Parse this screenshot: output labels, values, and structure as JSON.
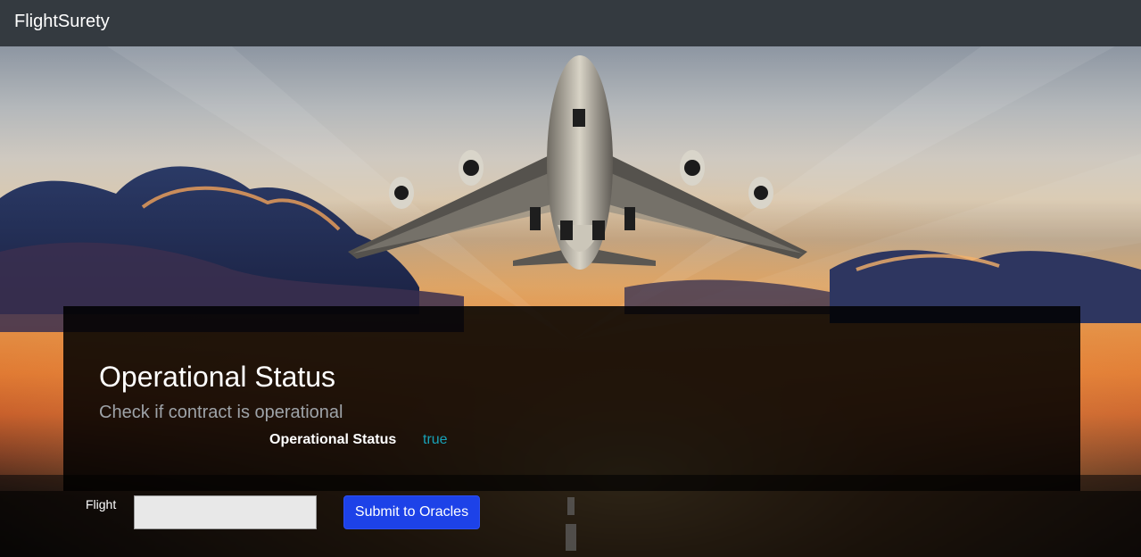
{
  "navbar": {
    "brand": "FlightSurety"
  },
  "hero": {
    "image": "airplane-over-sunset-runway"
  },
  "status_panel": {
    "title": "Operational Status",
    "subtitle": "Check if contract is operational",
    "status_label": "Operational Status",
    "status_value": "true",
    "status_value_color": "#17a2b8"
  },
  "oracle_form": {
    "flight_label": "Flight",
    "flight_value": "",
    "flight_placeholder": "",
    "submit_label": "Submit to Oracles",
    "submit_color": "#1d42e8"
  },
  "colors": {
    "navbar_bg": "#343a40",
    "panel_bg": "rgba(0,0,0,0.86)"
  }
}
